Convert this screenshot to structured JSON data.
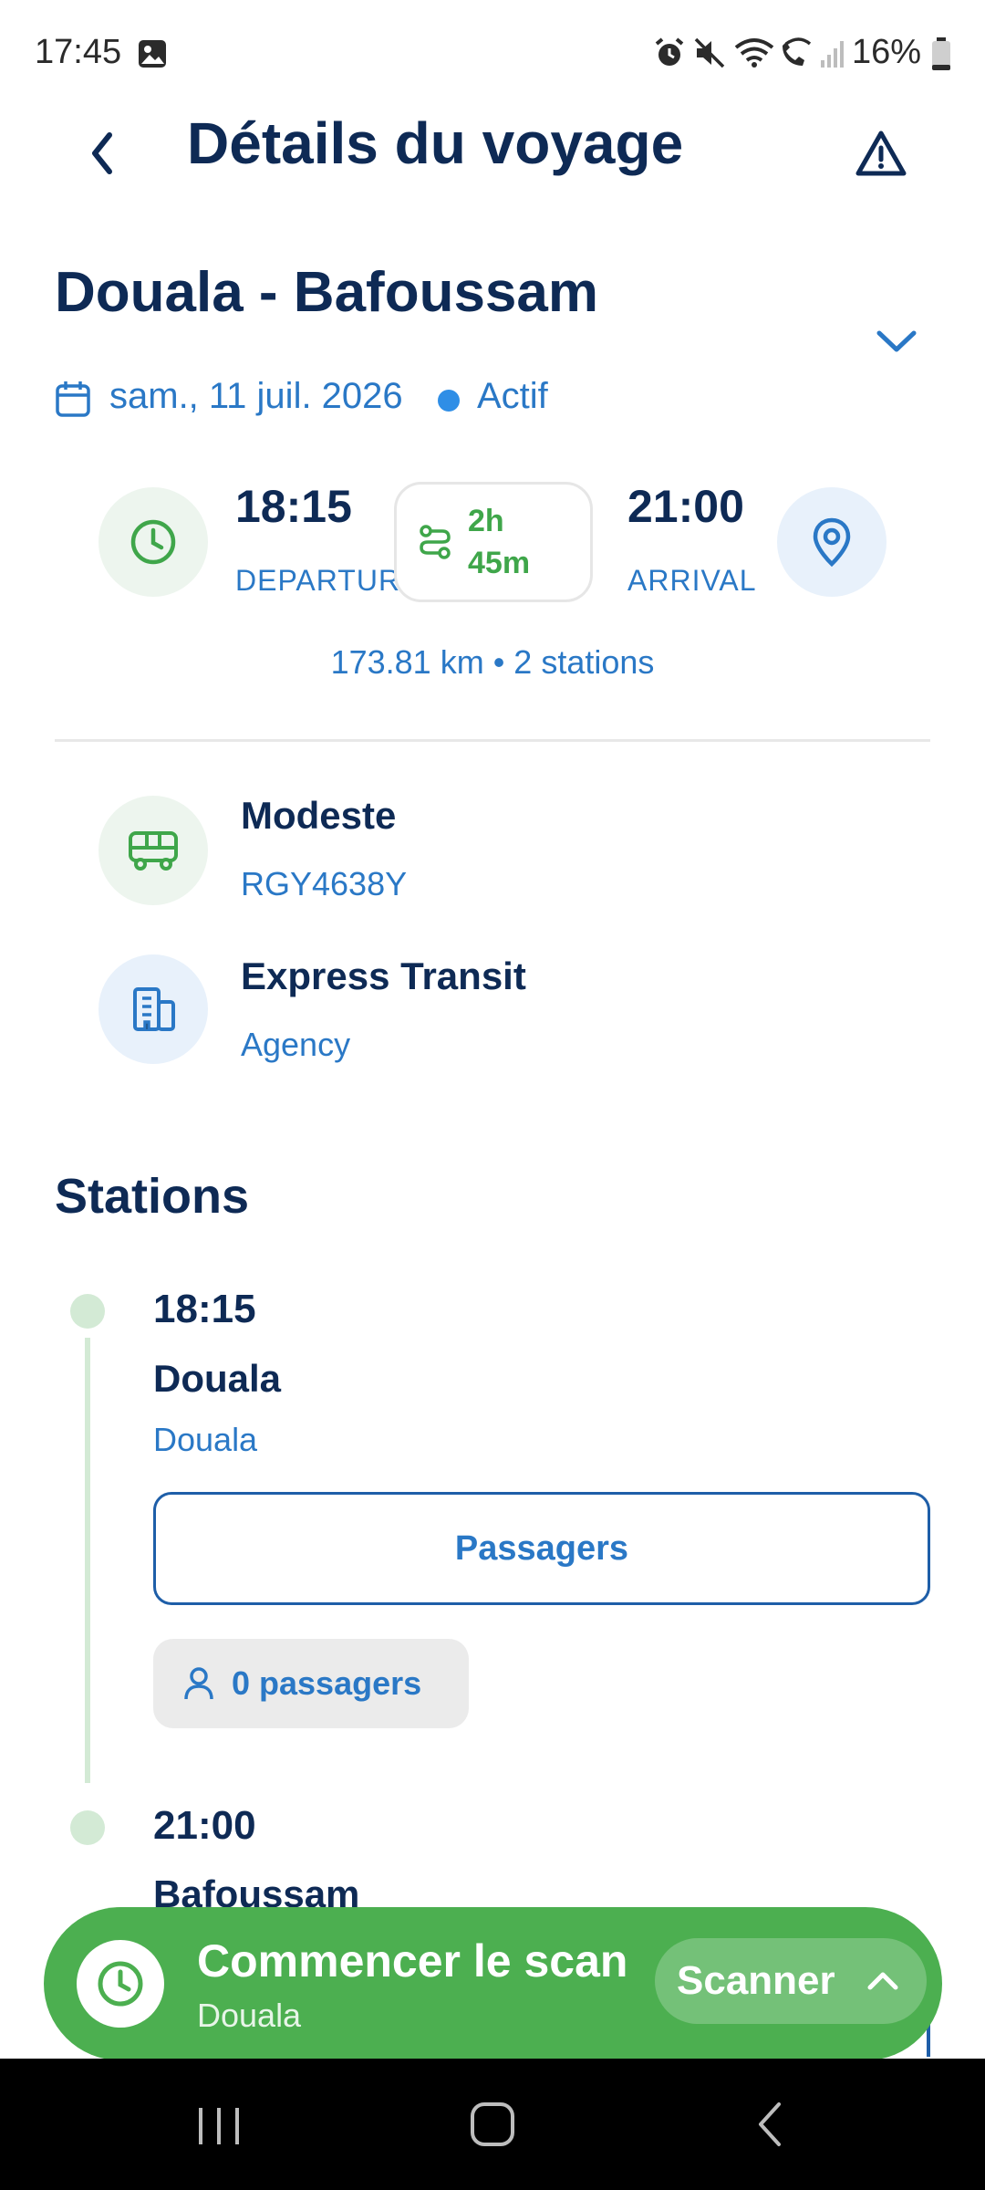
{
  "status_bar": {
    "time": "17:45",
    "battery": "16%",
    "icons": [
      "image-icon",
      "alarm-icon",
      "mute-icon",
      "wifi-icon",
      "wifi-call-icon",
      "signal-icon",
      "battery-icon"
    ]
  },
  "header": {
    "title": "Détails du voyage",
    "back_icon": "chevron-left-icon",
    "report_icon": "warning-icon"
  },
  "trip": {
    "route": "Douala - Bafoussam",
    "date": "sam., 11 juil. 2026",
    "status": "Actif",
    "departure_time": "18:15",
    "departure_label": "DEPARTURE",
    "duration_line1": "2h",
    "duration_line2": "45m",
    "arrival_time": "21:00",
    "arrival_label": "ARRIVAL",
    "distance_summary": "173.81 km • 2 stations"
  },
  "vehicle": {
    "name": "Modeste",
    "plate": "RGY4638Y"
  },
  "agency": {
    "name": "Express Transit",
    "label": "Agency"
  },
  "stations": {
    "title": "Stations",
    "items": [
      {
        "time": "18:15",
        "name": "Douala",
        "city": "Douala",
        "passengers_button": "Passagers",
        "passenger_count": "0 passagers"
      },
      {
        "time": "21:00",
        "name": "Bafoussam"
      }
    ]
  },
  "scan_bar": {
    "title": "Commencer le scan",
    "subtitle": "Douala",
    "button": "Scanner"
  },
  "colors": {
    "navy": "#0e2a55",
    "blue": "#2a78c6",
    "green": "#4caf50",
    "light_green": "#d3ead5"
  }
}
